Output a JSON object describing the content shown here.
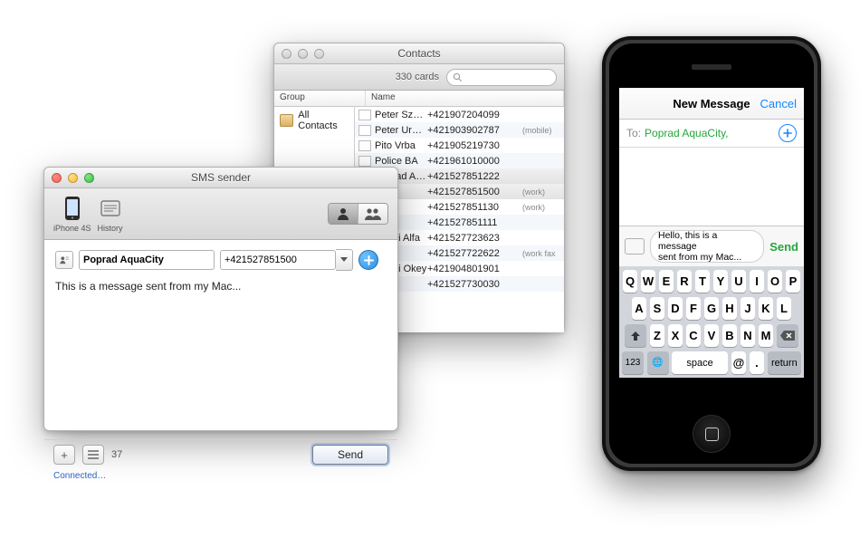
{
  "contacts": {
    "title": "Contacts",
    "count_label": "330 cards",
    "headers": {
      "group": "Group",
      "name": "Name"
    },
    "group_all": "All Contacts",
    "rows": [
      {
        "name": "Peter Szakál (…)",
        "phone": "+421907204099",
        "tag": "",
        "vcard": true
      },
      {
        "name": "Peter Urbančík",
        "phone": "+421903902787",
        "tag": "(mobile)",
        "vcard": true
      },
      {
        "name": "Pito Vrba",
        "phone": "+421905219730",
        "tag": "",
        "vcard": true
      },
      {
        "name": "Police BA",
        "phone": "+421961010000",
        "tag": "",
        "vcard": true
      },
      {
        "name": "Poprad AquaCity",
        "phone": "+421527851222",
        "tag": "",
        "vcard": true,
        "sel": true
      },
      {
        "name": "",
        "phone": "+421527851500",
        "tag": "(work)",
        "vcard": false,
        "sel": true
      },
      {
        "name": "",
        "phone": "+421527851130",
        "tag": "(work)",
        "vcard": false
      },
      {
        "name": "",
        "phone": "+421527851111",
        "tag": "",
        "vcard": false
      },
      {
        "name": "d Taxi Alfa",
        "phone": "+421527723623",
        "tag": "",
        "vcard": true
      },
      {
        "name": "",
        "phone": "+421527722622",
        "tag": "(work fax",
        "vcard": false
      },
      {
        "name": "d Taxi Okey",
        "phone": "+421904801901",
        "tag": "",
        "vcard": true
      },
      {
        "name": "",
        "phone": "+421527730030",
        "tag": "",
        "vcard": false
      }
    ]
  },
  "sms": {
    "title": "SMS sender",
    "toolbar": {
      "device": "iPhone 4S",
      "history": "History"
    },
    "recipient_name": "Poprad AquaCity",
    "recipient_phone": "+421527851500",
    "message": "This is a message sent from my Mac...",
    "char_count": "37",
    "send_label": "Send",
    "status": "Connected…"
  },
  "iphone": {
    "nav_title": "New Message",
    "cancel": "Cancel",
    "to_label": "To:",
    "to_value": "Poprad AquaCity,",
    "bubble_line1": "Hello, this is a message",
    "bubble_line2": "sent from my Mac...",
    "send": "Send",
    "kb_row1": [
      "Q",
      "W",
      "E",
      "R",
      "T",
      "Y",
      "U",
      "I",
      "O",
      "P"
    ],
    "kb_row2": [
      "A",
      "S",
      "D",
      "F",
      "G",
      "H",
      "J",
      "K",
      "L"
    ],
    "kb_row3": [
      "Z",
      "X",
      "C",
      "V",
      "B",
      "N",
      "M"
    ],
    "key_123": "123",
    "key_globe": "🌐",
    "key_space": "space",
    "key_at": "@",
    "key_dot": ".",
    "key_return": "return"
  }
}
